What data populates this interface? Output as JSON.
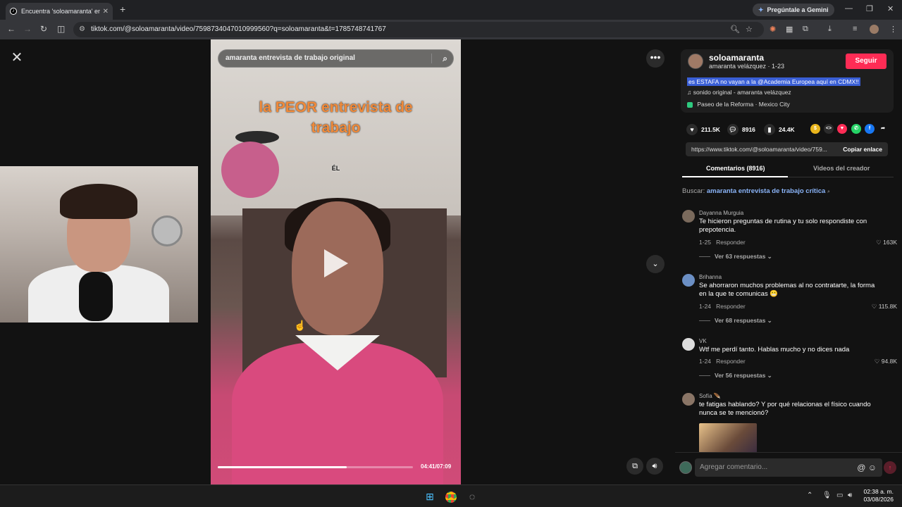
{
  "browser": {
    "tab_title": "Encuentra 'soloamaranta' en TikTok",
    "gemini_label": "Pregúntale a Gemini",
    "url": "tiktok.com/@soloamaranta/video/7598734047010999560?q=soloamaranta&t=1785748741767"
  },
  "video": {
    "search_text": "amaranta entrevista de trabajo original",
    "caption_line1": "la PEOR entrevista de",
    "caption_line2": "trabajo",
    "overlay_label": "ÉL",
    "time": "04:41/07:09",
    "progress": 0.66
  },
  "info": {
    "username": "soloamaranta",
    "subtitle": "amaranta velázquez · 1-23",
    "follow_label": "Seguir",
    "description": "es ESTAFA no vayan a la @Academia Europea aquí en CDMX!!",
    "music": "sonido original - amaranta velázquez",
    "location": "Paseo de la Reforma · Mexico City"
  },
  "stats": {
    "likes": "211.5K",
    "comments": "8916",
    "saves": "24.4K"
  },
  "link": {
    "url": "https://www.tiktok.com/@soloamaranta/video/759...",
    "copy_label": "Copiar enlace"
  },
  "tabs": {
    "comments": "Comentarios (8916)",
    "creator_videos": "Videos del creador"
  },
  "search_suggest": {
    "prefix": "Buscar:",
    "query": "amaranta entrevista de trabajo crítica"
  },
  "comments": [
    {
      "name": "Dayanna Murguia",
      "text": "Te hicieron preguntas de rutina y tu solo respondiste con prepotencia.",
      "date": "1-25",
      "reply": "Responder",
      "likes": "163K",
      "replies": "Ver 63 respuestas ⌄"
    },
    {
      "name": "Brihanna",
      "text": "Se ahorraron muchos problemas al no contratarte, la forma en la que te comunicas 😬",
      "date": "1-24",
      "reply": "Responder",
      "likes": "115.8K",
      "replies": "Ver 68 respuestas ⌄"
    },
    {
      "name": "VK",
      "text": "Wtf me perdí tanto. Hablas mucho y no dices nada",
      "date": "1-24",
      "reply": "Responder",
      "likes": "94.8K",
      "replies": "Ver 56 respuestas ⌄"
    },
    {
      "name": "Sofía 🪶",
      "text": "te fatigas hablando? Y por qué relacionas el físico cuando nunca se te mencionó?"
    }
  ],
  "comment_input": {
    "placeholder": "Agregar comentario..."
  },
  "taskbar": {
    "time": "02:38 a. m.",
    "date": "03/08/2026"
  }
}
